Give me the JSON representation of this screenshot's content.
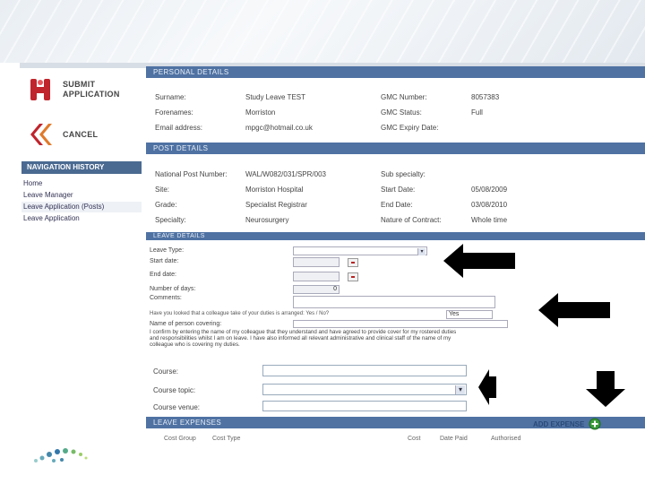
{
  "actions": {
    "submit": "SUBMIT APPLICATION",
    "cancel": "CANCEL"
  },
  "nav": {
    "heading": "NAVIGATION HISTORY",
    "items": [
      "Home",
      "Leave Manager",
      "Leave Application (Posts)",
      "Leave Application"
    ]
  },
  "personal": {
    "heading": "PERSONAL DETAILS",
    "surname_label": "Surname:",
    "surname": "Study Leave TEST",
    "forenames_label": "Forenames:",
    "forenames": "Morriston",
    "email_label": "Email address:",
    "email": "mpgc@hotmail.co.uk",
    "gmc_number_label": "GMC Number:",
    "gmc_number": "8057383",
    "gmc_status_label": "GMC Status:",
    "gmc_status": "Full",
    "gmc_expiry_label": "GMC Expiry Date:"
  },
  "post": {
    "heading": "POST DETAILS",
    "national_post_label": "National Post Number:",
    "national_post": "WAL/W082/031/SPR/003",
    "site_label": "Site:",
    "site": "Morriston Hospital",
    "grade_label": "Grade:",
    "grade": "Specialist Registrar",
    "specialty_label": "Specialty:",
    "specialty": "Neurosurgery",
    "sub_specialty_label": "Sub specialty:",
    "start_label": "Start Date:",
    "start": "05/08/2009",
    "end_label": "End Date:",
    "end": "03/08/2010",
    "contract_label": "Nature of Contract:",
    "contract": "Whole time"
  },
  "leave": {
    "heading": "LEAVE DETAILS",
    "type_label": "Leave Type:",
    "start_label": "Start date:",
    "end_label": "End date:",
    "days_label": "Number of days:",
    "days_value": "0",
    "comments_label": "Comments:",
    "cover_question": "Have you looked that a colleague take of your duties is arranged: Yes / No?",
    "cover_select": "Yes",
    "cover_name_label": "Name of person covering:",
    "confirm_text_1": "I confirm by entering the name of my colleague that they understand and have agreed to provide cover for my rostered duties",
    "confirm_text_2": "and responsibilities whilst I am on leave. I have also informed all relevant administrative and clinical staff of the name of my",
    "confirm_text_3": "colleague who is covering my duties."
  },
  "course": {
    "course_label": "Course:",
    "topic_label": "Course topic:",
    "venue_label": "Course venue:"
  },
  "expenses": {
    "heading": "LEAVE EXPENSES",
    "add_label": "ADD EXPENSE",
    "columns": [
      "Cost Group",
      "Cost Type",
      "Cost",
      "Date Paid",
      "Authorised"
    ]
  },
  "colors": {
    "section_header": "#4f72a3",
    "nav_header": "#4a6a91",
    "add_icon": "#3a9a3a"
  },
  "icons": [
    "submit-application-icon",
    "cancel-icon",
    "arrow-left-icon",
    "arrow-down-icon",
    "add-icon",
    "calendar-icon",
    "chevron-down-icon"
  ]
}
